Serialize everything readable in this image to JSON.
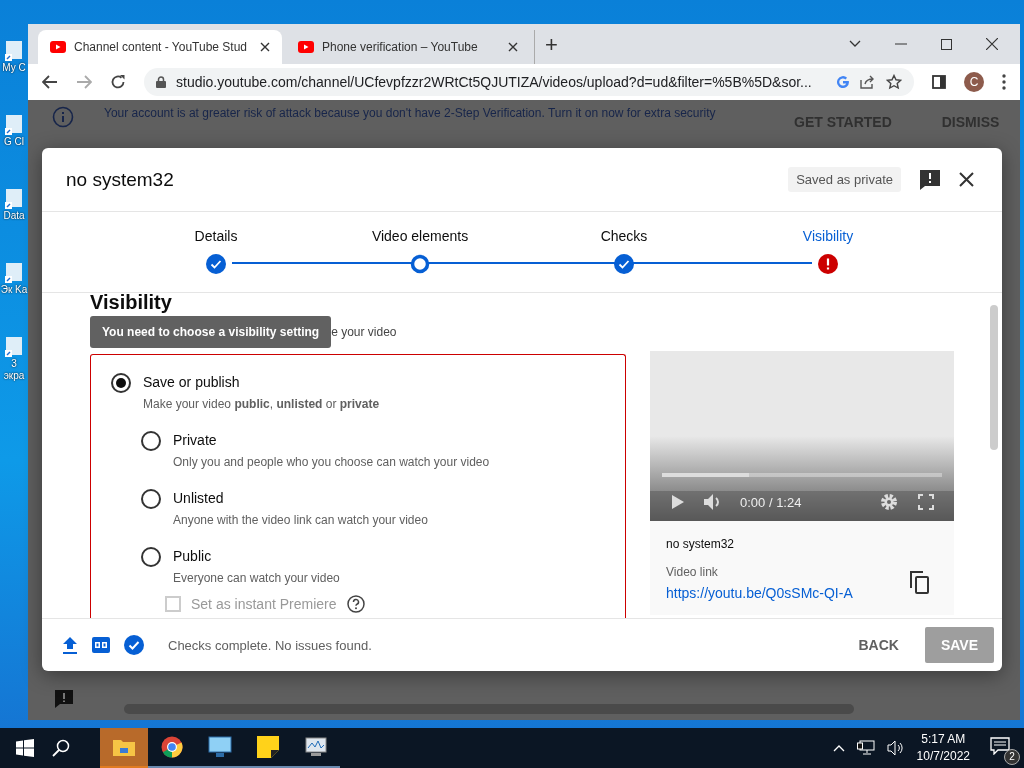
{
  "desktop_icons": [
    {
      "label": "My C"
    },
    {
      "label": "G Cl"
    },
    {
      "label": "Data"
    },
    {
      "label": "Эк Ka"
    },
    {
      "label": "3 экра"
    }
  ],
  "browser": {
    "tabs": [
      {
        "title": "Channel content - YouTube Stud",
        "selected": true
      },
      {
        "title": "Phone verification – YouTube",
        "selected": false
      }
    ],
    "new_tab": "+",
    "url": "studio.youtube.com/channel/UCfevpfzzr2WRtCt5QJUTIZA/videos/upload?d=ud&filter=%5B%5D&sor...",
    "profile_initial": "C"
  },
  "banner": {
    "text": "Your account is at greater risk of attack because you don't have 2-Step Verification. Turn it on now for extra security",
    "actions": [
      "GET STARTED",
      "DISMISS"
    ]
  },
  "dialog": {
    "title": "no system32",
    "status": "Saved as private",
    "steps": [
      {
        "label": "Details",
        "kind": "done",
        "selected": false
      },
      {
        "label": "Video elements",
        "kind": "current",
        "selected": false
      },
      {
        "label": "Checks",
        "kind": "done",
        "selected": false
      },
      {
        "label": "Visibility",
        "kind": "error",
        "selected": true
      }
    ],
    "heading": "Visibility",
    "subtitle_visible": "e your video",
    "tooltip": "You need to choose a visibility setting",
    "main_option": {
      "label": "Save or publish",
      "description": "Make your video **public**, **unlisted** or **private**",
      "selected": true
    },
    "options": [
      {
        "label": "Private",
        "description": "Only you and people who you choose can watch your video",
        "selected": false
      },
      {
        "label": "Unlisted",
        "description": "Anyone with the video link can watch your video",
        "selected": false
      },
      {
        "label": "Public",
        "description": "Everyone can watch your video",
        "selected": false
      }
    ],
    "premiere": {
      "label": "Set as instant Premiere",
      "checked": false,
      "disabled": true
    },
    "player": {
      "time": "0:00 / 1:24",
      "progress": {
        "level": 0.31
      }
    },
    "video_title": "no system32",
    "link_label": "Video link",
    "link": "https://youtu.be/Q0sSMc-QI-A",
    "footer_status": "Checks complete. No issues found.",
    "back": "BACK",
    "save": {
      "label": "SAVE",
      "disabled": true
    }
  },
  "taskbar": {
    "apps": [
      {
        "kind": "explorer",
        "selected": true
      },
      {
        "kind": "chrome",
        "selected": false
      },
      {
        "kind": "monitor",
        "selected": false
      },
      {
        "kind": "notes",
        "selected": false
      },
      {
        "kind": "perf",
        "selected": false
      }
    ],
    "time": "5:17 AM",
    "date": "10/7/2022",
    "notifications": "2"
  }
}
